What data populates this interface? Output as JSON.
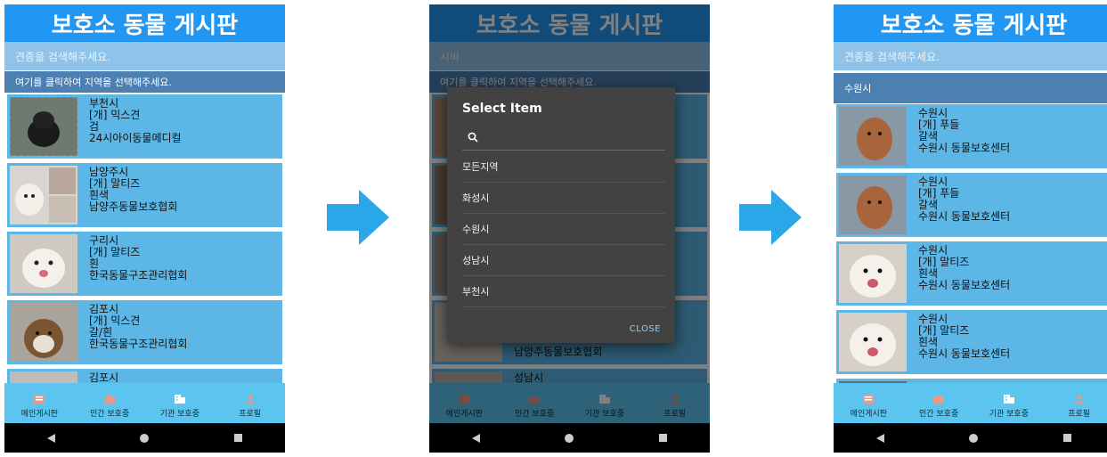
{
  "app_title": "보호소 동물 게시판",
  "search_placeholder": "견종을 검색해주세요.",
  "tabs": [
    "메인게시판",
    "민간 보호중",
    "기관 보호중",
    "프로필"
  ],
  "screen1": {
    "region_label": "여기를 클릭하여 지역을 선택해주세요.",
    "cards": [
      {
        "city": "부천시",
        "breed": "[개] 믹스견",
        "color": "검",
        "shelter": "24시아이동물메디컬"
      },
      {
        "city": "남양주시",
        "breed": "[개] 말티즈",
        "color": "흰색",
        "shelter": "남양주동물보호협회"
      },
      {
        "city": "구리시",
        "breed": "[개] 말티즈",
        "color": "흰",
        "shelter": "한국동물구조관리협회"
      },
      {
        "city": "김포시",
        "breed": "[개] 믹스견",
        "color": "갈/흰",
        "shelter": "한국동물구조관리협회"
      },
      {
        "city": "김포시",
        "breed": "",
        "color": "",
        "shelter": ""
      }
    ]
  },
  "screen2": {
    "search_text": "시바",
    "region_label": "여기를 클릭하여 지역을 선택해주세요.",
    "bg_lines": [
      "남양주동물보호협회",
      "성남시"
    ],
    "dialog": {
      "title": "Select Item",
      "items": [
        "모든지역",
        "화성시",
        "수원시",
        "성남시",
        "부천시"
      ],
      "close_label": "CLOSE"
    }
  },
  "screen3": {
    "region_label": "수원시",
    "cards": [
      {
        "city": "수원시",
        "breed": "[개] 푸들",
        "color": "갈색",
        "shelter": "수원시 동물보호센터"
      },
      {
        "city": "수원시",
        "breed": "[개] 푸들",
        "color": "갈색",
        "shelter": "수원시 동물보호센터"
      },
      {
        "city": "수원시",
        "breed": "[개] 말티즈",
        "color": "흰색",
        "shelter": "수원시 동물보호센터"
      },
      {
        "city": "수원시",
        "breed": "[개] 말티즈",
        "color": "흰색",
        "shelter": "수원시 동물보호센터"
      }
    ]
  },
  "icons": {
    "tab_icons": [
      "board-icon",
      "building-icon",
      "building-icon",
      "person-icon"
    ],
    "arrow": "right-arrow-icon",
    "search": "search-icon"
  },
  "colors": {
    "title_bg": "#2196f3",
    "card_bg": "#5db7e6",
    "tabbar_bg": "#5bc5f0",
    "arrow": "#2aa7e8",
    "dialog_bg": "#424242"
  }
}
